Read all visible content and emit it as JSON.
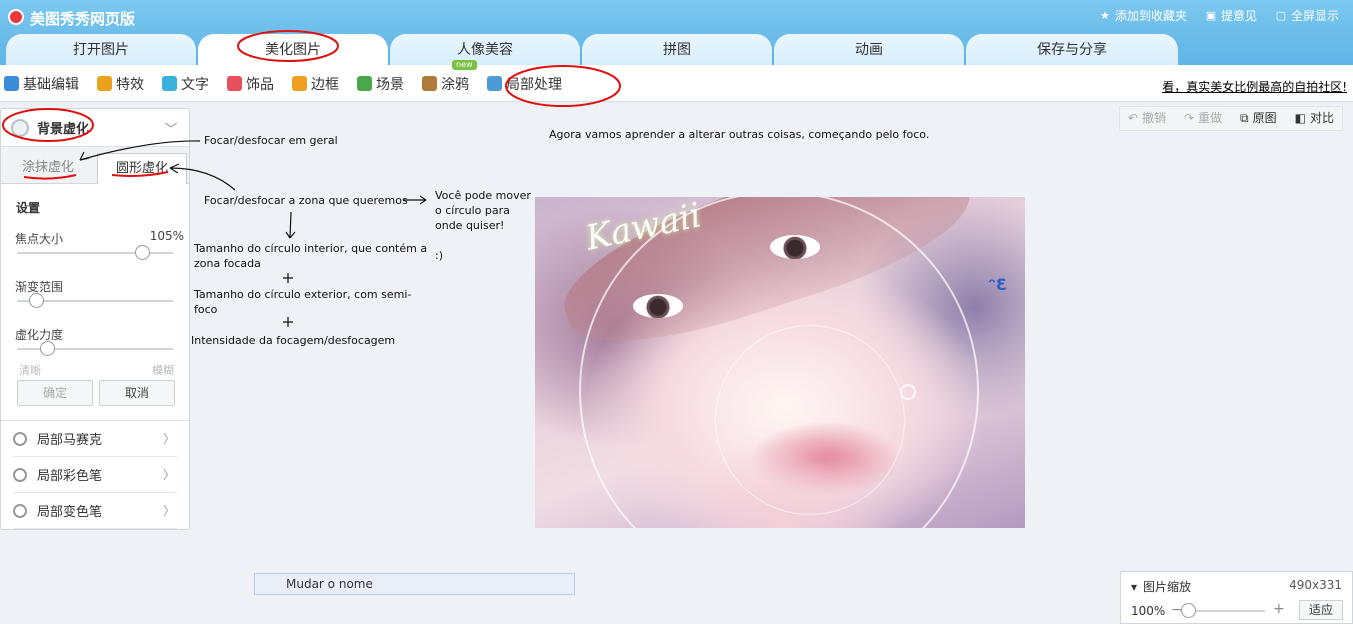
{
  "app": {
    "title": "美图秀秀网页版"
  },
  "top_links": [
    {
      "icon": "star-icon",
      "label": "添加到收藏夹"
    },
    {
      "icon": "chat-icon",
      "label": "提意见"
    },
    {
      "icon": "fullscreen-icon",
      "label": "全屏显示"
    }
  ],
  "main_tabs": [
    "打开图片",
    "美化图片",
    "人像美容",
    "拼图",
    "动画",
    "保存与分享"
  ],
  "main_tabs_active": "美化图片",
  "sub_items": [
    {
      "label": "基础编辑",
      "icon": "basic-edit-icon",
      "color": "#3b8bd9"
    },
    {
      "label": "特效",
      "icon": "wand-icon",
      "color": "#e8a21d"
    },
    {
      "label": "文字",
      "icon": "text-t-icon",
      "color": "#3bb0d9"
    },
    {
      "label": "饰品",
      "icon": "bow-icon",
      "color": "#e8505b"
    },
    {
      "label": "边框",
      "icon": "frame-icon",
      "color": "#f0a020"
    },
    {
      "label": "场景",
      "icon": "scene-icon",
      "color": "#4aa84a"
    },
    {
      "label": "涂鸦",
      "icon": "brush-icon",
      "color": "#b07a3a",
      "badge": "new"
    },
    {
      "label": "局部处理",
      "icon": "dropper-icon",
      "color": "#4d9bd6"
    }
  ],
  "community_link": "看，真实美女比例最高的自拍社区!",
  "panel": {
    "title": "背景虚化",
    "tabs": [
      "涂抹虚化",
      "圆形虚化"
    ],
    "settings_title": "设置",
    "sliders": [
      {
        "label": "焦点大小",
        "value": "105%",
        "level": 0.8
      },
      {
        "label": "渐变范围",
        "value": "",
        "level": 0.12
      },
      {
        "label": "虚化力度",
        "value": "",
        "level": 0.19
      }
    ],
    "range_left": "清晰",
    "range_right": "模糊",
    "ok_label": "确定",
    "cancel_label": "取消",
    "tools": [
      "局部马赛克",
      "局部彩色笔",
      "局部变色笔"
    ]
  },
  "edit_tools": {
    "undo": "撤销",
    "redo": "重做",
    "original": "原图",
    "compare": "对比"
  },
  "notes": {
    "intro": "Agora vamos aprender a alterar outras coisas, começando pelo foco.",
    "n1": "Focar/desfocar em geral",
    "n2": "Focar/desfocar a zona que queremos",
    "n3a": "Você pode mover",
    "n3b": "o círculo para",
    "n3c": "onde quiser!",
    "n3d": ":)",
    "n4a": "Tamanho do círculo interior, que contém a",
    "n4b": "zona focada",
    "n5a": "Tamanho do círculo exterior, com semi-",
    "n5b": "foco",
    "n6": "Intensidade da focagem/desfocagem"
  },
  "photo": {
    "text": "Kawaii",
    "emote": "ᵔƐ"
  },
  "rename": "Mudar o nome",
  "zoom": {
    "title": "图片缩放",
    "size": "490x331",
    "pct": "100%",
    "fit": "适应",
    "level": 0.0
  }
}
